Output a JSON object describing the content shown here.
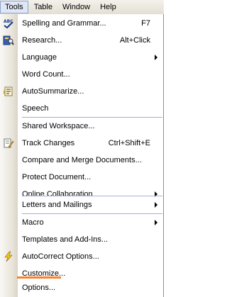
{
  "menubar": {
    "tools": "Tools",
    "table": "Table",
    "window": "Window",
    "help": "Help"
  },
  "menu": {
    "items": [
      {
        "label": "Spelling and Grammar...",
        "shortcut": "F7"
      },
      {
        "label": "Research...",
        "shortcut": "Alt+Click"
      },
      {
        "label": "Language",
        "submenu": true
      },
      {
        "label": "Word Count..."
      },
      {
        "label": "AutoSummarize..."
      },
      {
        "label": "Speech"
      },
      {
        "label": "Shared Workspace..."
      },
      {
        "label": "Track Changes",
        "shortcut": "Ctrl+Shift+E"
      },
      {
        "label": "Compare and Merge Documents..."
      },
      {
        "label": "Protect Document..."
      },
      {
        "label": "Online Collaboration",
        "submenu": true
      },
      {
        "label": "Letters and Mailings",
        "submenu": true
      },
      {
        "label": "Macro",
        "submenu": true
      },
      {
        "label": "Templates and Add-Ins..."
      },
      {
        "label": "AutoCorrect Options..."
      },
      {
        "label": "Customize..."
      },
      {
        "label": "Options..."
      }
    ]
  },
  "icons": {
    "spelling": "spelling-abc-check-icon",
    "research": "research-book-icon",
    "autosummarize": "autosummarize-icon",
    "track_changes": "track-changes-pencil-icon",
    "autocorrect": "autocorrect-lightning-icon"
  },
  "colors": {
    "highlight_underline": "#ff7f27",
    "separator": "#9fb1d6",
    "active_menu_bg": "#dfe6f4"
  }
}
